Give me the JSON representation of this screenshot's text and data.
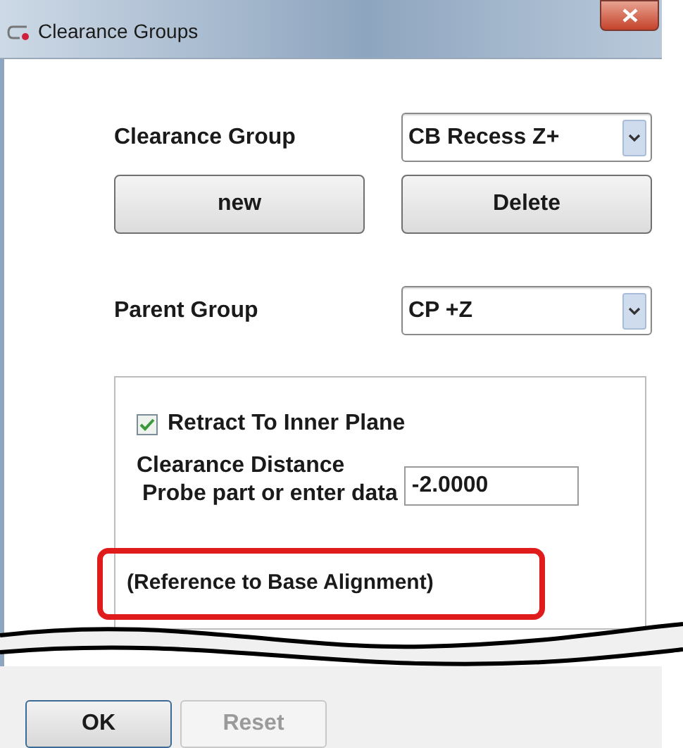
{
  "window": {
    "title": "Clearance Groups"
  },
  "clearance_group": {
    "label": "Clearance Group",
    "value": "CB Recess Z+"
  },
  "group_buttons": [
    {
      "label": "new"
    },
    {
      "label": "Delete"
    }
  ],
  "parent_group": {
    "label": "Parent Group",
    "value": "CP +Z"
  },
  "retract": {
    "label": "Retract To Inner Plane",
    "checked": true
  },
  "clearance_distance": {
    "label": "Clearance Distance",
    "sublabel": "Probe part or enter data",
    "value": "-2.0000"
  },
  "reference_note": {
    "text": "(Reference to Base Alignment)",
    "highlighted": true
  },
  "footer_buttons": [
    {
      "label": "OK",
      "disabled": false
    },
    {
      "label": "Reset",
      "disabled": true
    }
  ]
}
